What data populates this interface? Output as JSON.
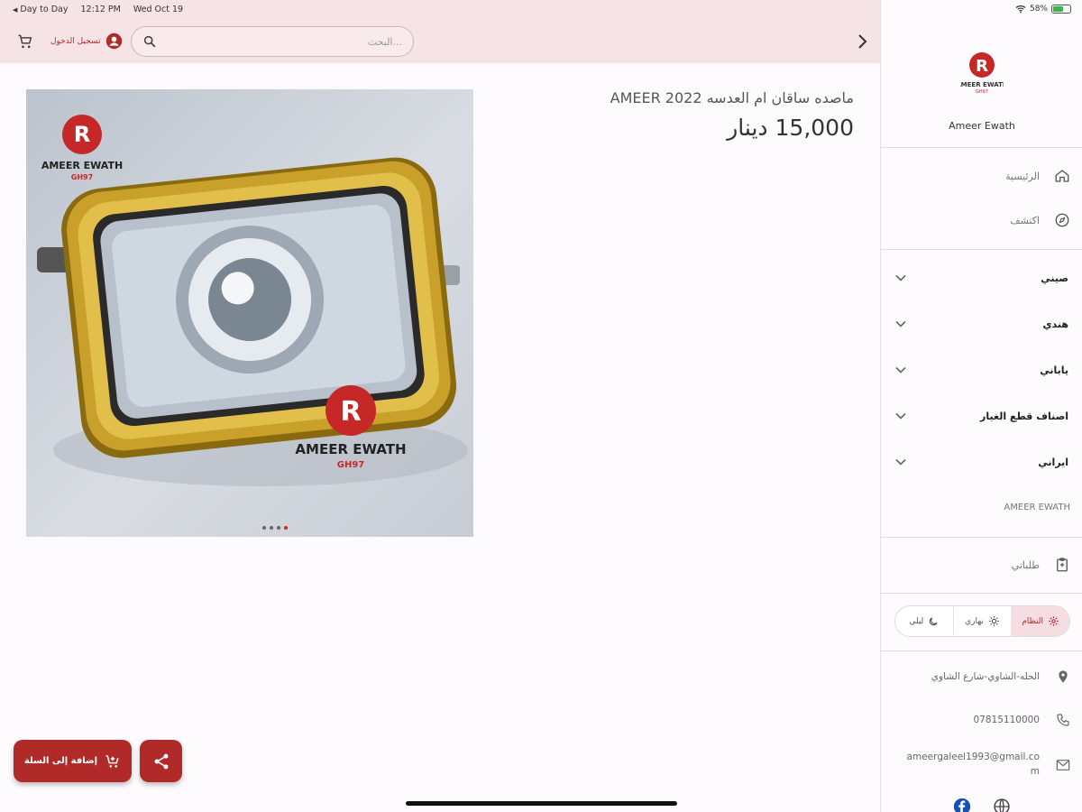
{
  "status_bar": {
    "back_app": "Day to Day",
    "time": "12:12 PM",
    "date": "Wed Oct 19",
    "battery": "58%"
  },
  "header": {
    "login_label": "تسجيل الدخول",
    "search_placeholder": "البحث..."
  },
  "product": {
    "title": "ماصده ساقان ام العدسه  AMEER 2022",
    "price": "15,000 دينار",
    "image_watermark": "AMEER EWATH",
    "image_watermark_sub": "GH97",
    "image_count": 4,
    "active_image_index": 4
  },
  "actions": {
    "add_to_cart": "إضافة إلى السلة"
  },
  "drawer": {
    "logo_text": "AMEER EWATH",
    "logo_sub": "GH97",
    "store_name": "Ameer Ewath",
    "nav": [
      {
        "label": "الرئيسية",
        "icon": "home-icon"
      },
      {
        "label": "اكتشف",
        "icon": "compass-icon"
      }
    ],
    "categories": [
      {
        "label": "صيني"
      },
      {
        "label": "هندي"
      },
      {
        "label": "ياباني"
      },
      {
        "label": "اصناف قطع الغيار"
      },
      {
        "label": "ايراني"
      }
    ],
    "brand_item": "AMEER EWATH",
    "orders_label": "طلباتي",
    "theme": {
      "system": "النظام",
      "light": "نهاري",
      "dark": "ليلي",
      "selected": "system"
    },
    "contact": {
      "address": "الحله-الشاوي-شارع الشاوي",
      "phone": "07815110000",
      "email": "ameergaleel1993@gmail.com"
    }
  },
  "colors": {
    "accent": "#b02a2a",
    "header_bg": "#f6e3e6"
  }
}
